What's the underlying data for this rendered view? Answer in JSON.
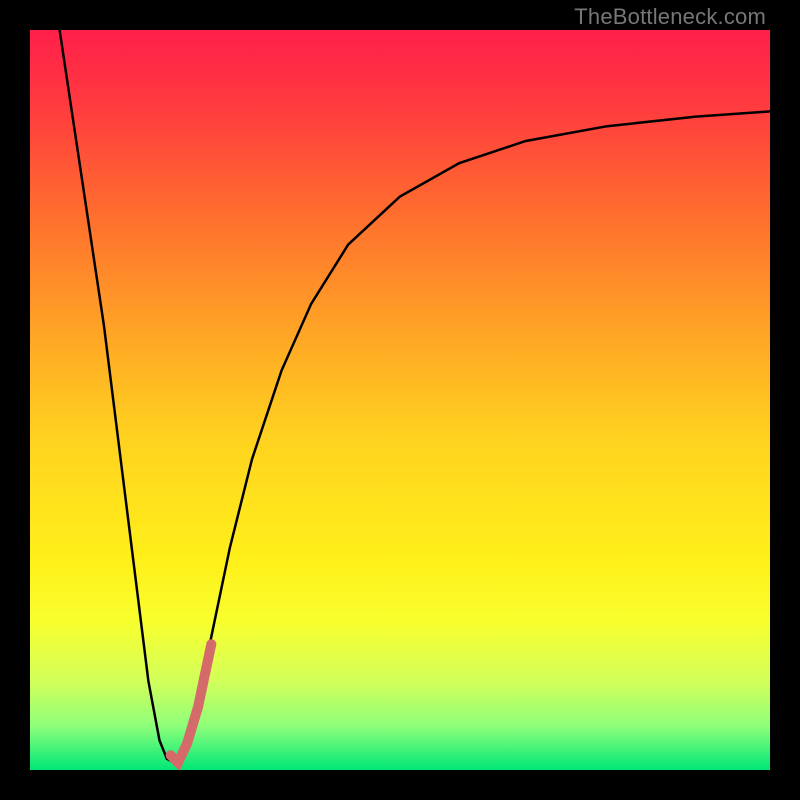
{
  "watermark": "TheBottleneck.com",
  "chart_data": {
    "type": "line",
    "title": "",
    "xlabel": "",
    "ylabel": "",
    "xlim": [
      0,
      100
    ],
    "ylim": [
      0,
      100
    ],
    "grid": false,
    "axis_ticks_visible": false,
    "background_gradient": {
      "style": "vertical",
      "stops": [
        {
          "pos": 0.0,
          "color": "#ff1f4a"
        },
        {
          "pos": 0.1,
          "color": "#ff3a3f"
        },
        {
          "pos": 0.25,
          "color": "#ff6e2e"
        },
        {
          "pos": 0.4,
          "color": "#ffa226"
        },
        {
          "pos": 0.55,
          "color": "#ffd21f"
        },
        {
          "pos": 0.72,
          "color": "#fff01a"
        },
        {
          "pos": 0.8,
          "color": "#f8ff2e"
        },
        {
          "pos": 0.88,
          "color": "#d2ff5a"
        },
        {
          "pos": 0.94,
          "color": "#8fff7a"
        },
        {
          "pos": 1.0,
          "color": "#00e777"
        }
      ]
    },
    "series": [
      {
        "name": "black-curve",
        "color": "#000000",
        "width": 2.5,
        "points": [
          {
            "x": 4.0,
            "y": 100.0
          },
          {
            "x": 7.0,
            "y": 80.0
          },
          {
            "x": 10.0,
            "y": 60.0
          },
          {
            "x": 12.5,
            "y": 40.0
          },
          {
            "x": 14.5,
            "y": 24.0
          },
          {
            "x": 16.0,
            "y": 12.0
          },
          {
            "x": 17.5,
            "y": 4.0
          },
          {
            "x": 18.5,
            "y": 1.5
          },
          {
            "x": 19.5,
            "y": 1.0
          },
          {
            "x": 21.0,
            "y": 3.0
          },
          {
            "x": 22.5,
            "y": 8.0
          },
          {
            "x": 24.5,
            "y": 18.0
          },
          {
            "x": 27.0,
            "y": 30.0
          },
          {
            "x": 30.0,
            "y": 42.0
          },
          {
            "x": 34.0,
            "y": 54.0
          },
          {
            "x": 38.0,
            "y": 63.0
          },
          {
            "x": 43.0,
            "y": 71.0
          },
          {
            "x": 50.0,
            "y": 77.5
          },
          {
            "x": 58.0,
            "y": 82.0
          },
          {
            "x": 67.0,
            "y": 85.0
          },
          {
            "x": 78.0,
            "y": 87.0
          },
          {
            "x": 90.0,
            "y": 88.3
          },
          {
            "x": 100.0,
            "y": 89.0
          }
        ]
      },
      {
        "name": "highlight-salmon",
        "color": "#d46a6a",
        "width": 10,
        "linecap": "round",
        "points": [
          {
            "x": 19.0,
            "y": 2.0
          },
          {
            "x": 20.0,
            "y": 1.0
          },
          {
            "x": 21.2,
            "y": 3.5
          },
          {
            "x": 22.7,
            "y": 8.5
          },
          {
            "x": 24.5,
            "y": 17.0
          }
        ]
      }
    ]
  }
}
